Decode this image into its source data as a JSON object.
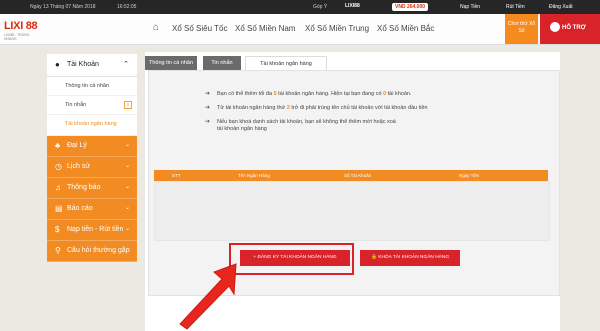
{
  "topbar": {
    "date": "Ngày 13 Tháng 07 Năm 2018",
    "time": "16:52:05",
    "gopy": "Góp Ý",
    "username": "LIXI88",
    "balance": "VND 264,000",
    "actions": [
      "Nạp Tiền",
      "Rút Tiền",
      "Đăng Xuất"
    ]
  },
  "logo": {
    "title": "LIXI 88",
    "tagline": "LIXI88 - TRÚNG NHANH"
  },
  "nav": {
    "links": [
      "Xổ Số Siêu Tốc",
      "Xổ Số Miền Nam",
      "Xổ Số Miền Trung",
      "Xổ Số Miền Bắc"
    ],
    "choose_lottery": "Chơi thử Xổ Số",
    "support": "HỖ TRỢ"
  },
  "sidebar": {
    "account": "Tài Khoản",
    "subitems": [
      "Thông tin cá nhân",
      "Tin nhắn",
      "Tài khoản ngân hàng"
    ],
    "message_badge": "0",
    "sections": [
      "Đại Lý",
      "Lịch sử",
      "Thông báo",
      "Báo cáo",
      "Nạp tiền - Rút tiền",
      "Câu hỏi thường gặp"
    ]
  },
  "tabs": [
    "Thông tin cá nhân",
    "Tin nhắn",
    "Tài khoản ngân hàng"
  ],
  "notes": {
    "n1a": "Bạn có thể thêm tối đa ",
    "n1b": "5",
    "n1c": " tài khoản ngân hàng. Hiện tại bạn đang có ",
    "n1d": "0",
    "n1e": " tài khoản.",
    "n2a": "Từ tài khoản ngân hàng thứ ",
    "n2b": "2",
    "n2c": " trở đi phải trùng tên chủ tài khoản với tài khoản đầu tiên",
    "n3": "Nếu bạn khoá danh sách tài khoản, bạn sẽ không thể thêm mới hoặc xoá tài khoản ngân hàng"
  },
  "table": {
    "headers": [
      "STT",
      "Tên Ngân Hàng",
      "Số Tài Khoản",
      "Ngày Tiền"
    ]
  },
  "buttons": {
    "register": "+ ĐĂNG KÝ TÀI KHOẢN NGÂN HÀNG",
    "lock": "🔒 KHÓA TÀI KHOẢN NGÂN HÀNG"
  },
  "colors": {
    "accent": "#f28c22",
    "red": "#d8232a",
    "topbar": "#262626"
  }
}
